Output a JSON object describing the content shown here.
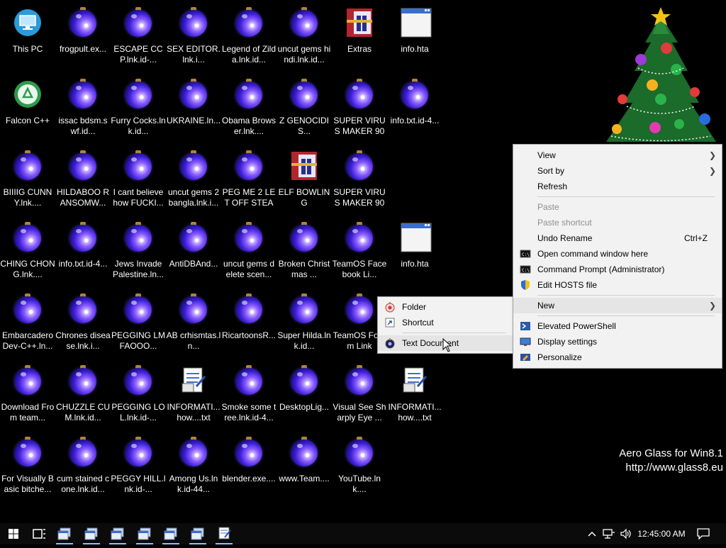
{
  "desktop": {
    "icons": [
      {
        "label": "This PC",
        "icon": "monitor-icon"
      },
      {
        "label": "frogpult.ex...",
        "icon": "ornament-icon"
      },
      {
        "label": "ESCAPE CCP.lnk.id-...",
        "icon": "ornament-icon"
      },
      {
        "label": "SEX EDITOR.lnk.i...",
        "icon": "ornament-icon"
      },
      {
        "label": "Legend of Zilda.lnk.id...",
        "icon": "ornament-icon"
      },
      {
        "label": "uncut gems hindi.lnk.id...",
        "icon": "ornament-icon"
      },
      {
        "label": "Extras",
        "icon": "winrar-icon"
      },
      {
        "label": "info.hta",
        "icon": "window-icon"
      },
      {
        "label": "Falcon C++",
        "icon": "recycle-icon"
      },
      {
        "label": "issac bdsm.swf.id...",
        "icon": "ornament-icon"
      },
      {
        "label": "Furry Cocks.lnk.id...",
        "icon": "ornament-icon"
      },
      {
        "label": "UKRAINE.ln...",
        "icon": "ornament-icon"
      },
      {
        "label": "Obama Browser.lnk....",
        "icon": "ornament-icon"
      },
      {
        "label": "Z GENOCIDIS...",
        "icon": "ornament-icon"
      },
      {
        "label": "SUPER VIRUS MAKER 900...",
        "icon": "ornament-icon"
      },
      {
        "label": "info.txt.id-4...",
        "icon": "ornament-icon"
      },
      {
        "label": "BIIIIG CUNNY.lnk....",
        "icon": "ornament-icon"
      },
      {
        "label": "HILDABOO RANSOMW...",
        "icon": "ornament-icon"
      },
      {
        "label": "I cant believe how FUCKI...",
        "icon": "ornament-icon"
      },
      {
        "label": "uncut gems 2 bangla.lnk.i...",
        "icon": "ornament-icon"
      },
      {
        "label": "PEG ME 2 LET OFF STEAM....",
        "icon": "ornament-icon"
      },
      {
        "label": "ELF BOWLING",
        "icon": "winrar-icon"
      },
      {
        "label": "SUPER VIRUS MAKER 900...",
        "icon": "ornament-icon"
      },
      {
        "label": "CHING CHONG.lnk....",
        "icon": "ornament-icon"
      },
      {
        "label": "info.txt.id-4...",
        "icon": "ornament-icon"
      },
      {
        "label": "Jews Invade Palestine.ln...",
        "icon": "ornament-icon"
      },
      {
        "label": "AntiDBAnd...",
        "icon": "ornament-icon"
      },
      {
        "label": "uncut gems delete scen...",
        "icon": "ornament-icon"
      },
      {
        "label": "Broken Christmas ...",
        "icon": "ornament-icon"
      },
      {
        "label": "TeamOS Facebook Li...",
        "icon": "ornament-icon"
      },
      {
        "label": "info.hta",
        "icon": "window-icon"
      },
      {
        "label": "Embarcadero Dev-C++.ln...",
        "icon": "ornament-icon"
      },
      {
        "label": "Chrones disease.lnk.i...",
        "icon": "ornament-icon"
      },
      {
        "label": "PEGGING LMFAOOO...",
        "icon": "ornament-icon"
      },
      {
        "label": "AB crhismtas.ln...",
        "icon": "ornament-icon"
      },
      {
        "label": "RicartoonsR...",
        "icon": "ornament-icon"
      },
      {
        "label": "Super Hilda.lnk.id...",
        "icon": "ornament-icon"
      },
      {
        "label": "TeamOS Forum Link",
        "icon": "ornament-icon"
      },
      {
        "label": "Download From team...",
        "icon": "ornament-icon"
      },
      {
        "label": "CHUZZLE CUM.lnk.id...",
        "icon": "ornament-icon"
      },
      {
        "label": "PEGGING LOL.lnk.id-...",
        "icon": "ornament-icon"
      },
      {
        "label": "INFORMATI... how....txt",
        "icon": "text-document-icon"
      },
      {
        "label": "Smoke some tree.lnk.id-4...",
        "icon": "ornament-icon"
      },
      {
        "label": "DesktopLig...",
        "icon": "ornament-icon"
      },
      {
        "label": "Visual See Sharply Eye ...",
        "icon": "ornament-icon"
      },
      {
        "label": "INFORMATI... how....txt",
        "icon": "text-document-icon"
      },
      {
        "label": "For Visually Basic bitche...",
        "icon": "ornament-icon"
      },
      {
        "label": "cum stained cone.lnk.id...",
        "icon": "ornament-icon"
      },
      {
        "label": "PEGGY HILL.lnk.id-...",
        "icon": "ornament-icon"
      },
      {
        "label": "Among Us.lnk.id-44...",
        "icon": "ornament-icon"
      },
      {
        "label": "blender.exe....",
        "icon": "ornament-icon"
      },
      {
        "label": "www.Team....",
        "icon": "ornament-icon"
      },
      {
        "label": "YouTube.lnk....",
        "icon": "ornament-icon"
      }
    ]
  },
  "watermark": {
    "line1": "Aero Glass for Win8.1",
    "line2": "http://www.glass8.eu"
  },
  "context_menu": {
    "items": [
      {
        "label": "View",
        "submenu": true
      },
      {
        "label": "Sort by",
        "submenu": true
      },
      {
        "label": "Refresh"
      },
      {
        "separator": true
      },
      {
        "label": "Paste",
        "disabled": true
      },
      {
        "label": "Paste shortcut",
        "disabled": true
      },
      {
        "label": "Undo Rename",
        "shortcut": "Ctrl+Z"
      },
      {
        "label": "Open command window here",
        "icon": "cmd-icon"
      },
      {
        "label": "Command Prompt (Administrator)",
        "icon": "cmd-icon"
      },
      {
        "label": "Edit HOSTS file",
        "icon": "shield-icon"
      },
      {
        "separator": true
      },
      {
        "label": "New",
        "submenu": true,
        "highlighted": true
      },
      {
        "separator": true
      },
      {
        "label": "Elevated PowerShell",
        "icon": "powershell-icon"
      },
      {
        "label": "Display settings",
        "icon": "display-icon"
      },
      {
        "label": "Personalize",
        "icon": "personalize-icon"
      }
    ]
  },
  "new_submenu": {
    "items": [
      {
        "label": "Folder",
        "icon": "folder-icon"
      },
      {
        "label": "Shortcut",
        "icon": "shortcut-icon"
      },
      {
        "separator": true
      },
      {
        "label": "Text Document",
        "icon": "text-document-icon",
        "highlighted": true
      }
    ]
  },
  "taskbar": {
    "clock": "12:45:00 AM",
    "apps_count_label": ""
  }
}
